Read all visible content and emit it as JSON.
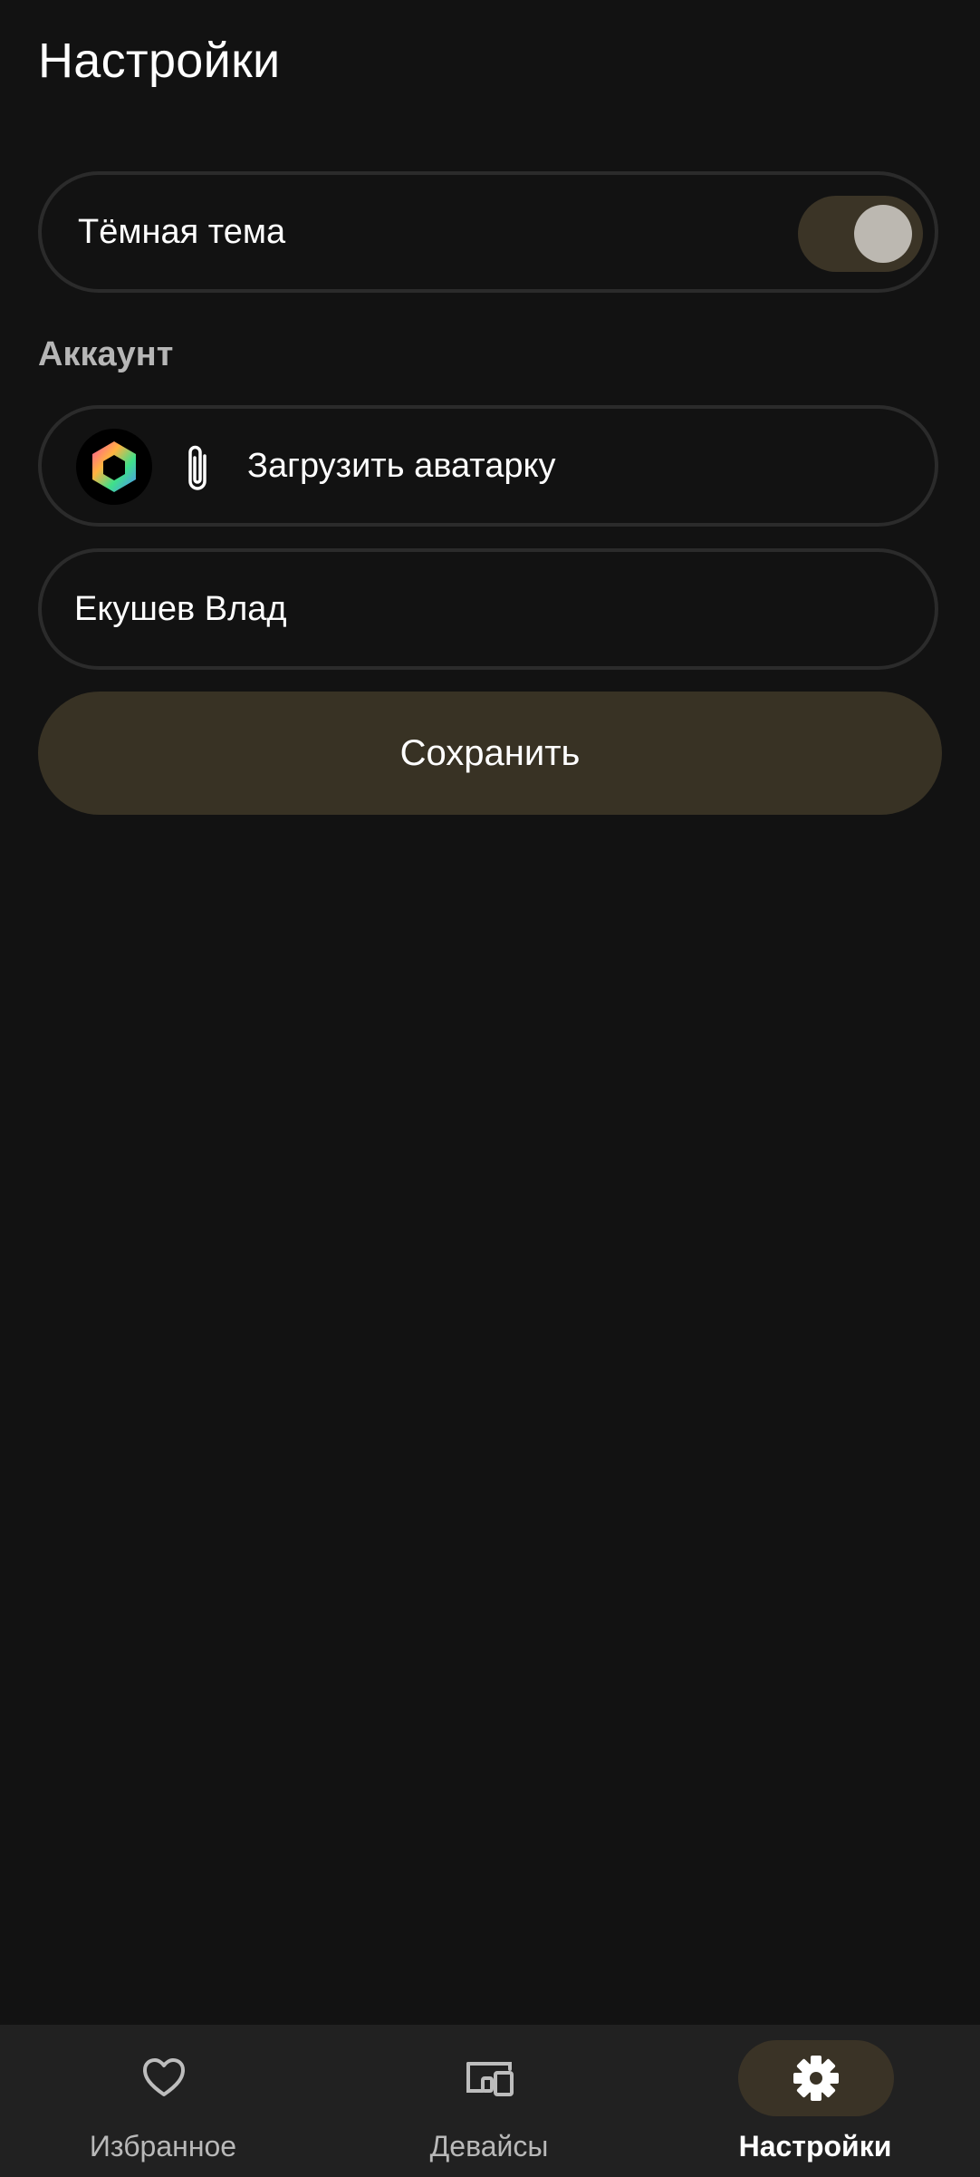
{
  "header": {
    "title": "Настройки"
  },
  "theme": {
    "label": "Тёмная тема",
    "enabled": true
  },
  "account": {
    "section_title": "Аккаунт",
    "upload_label": "Загрузить аватарку",
    "name_value": "Екушев Влад",
    "save_label": "Сохранить"
  },
  "bottom_nav": {
    "items": [
      {
        "label": "Избранное",
        "icon": "heart-icon",
        "active": false
      },
      {
        "label": "Девайсы",
        "icon": "devices-icon",
        "active": false
      },
      {
        "label": "Настройки",
        "icon": "gear-icon",
        "active": true
      }
    ]
  },
  "colors": {
    "background": "#121212",
    "accent_container": "#3a3326",
    "toggle_knob": "#bcb8b1",
    "nav_background": "#212121"
  }
}
